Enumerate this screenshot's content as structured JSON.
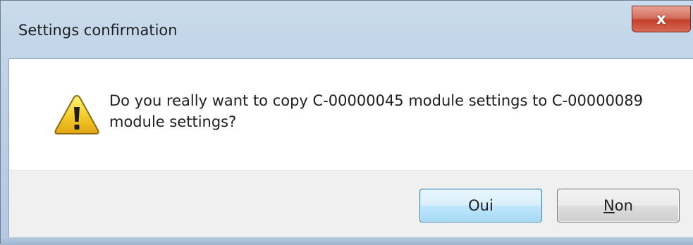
{
  "window": {
    "title": "Settings confirmation",
    "close_glyph": "x",
    "close_icon": "close-icon"
  },
  "dialog": {
    "icon": "warning-icon",
    "message": "Do you really want to copy C-00000045 module settings to C-00000089 module settings?"
  },
  "buttons": {
    "yes_label": "Oui",
    "no_accel": "N",
    "no_rest": "on"
  },
  "colors": {
    "title_bar": "#bcd0e6",
    "close_button": "#c4402a",
    "warning_fill": "#f4cf2e",
    "default_button_border": "#3c7fb1"
  }
}
